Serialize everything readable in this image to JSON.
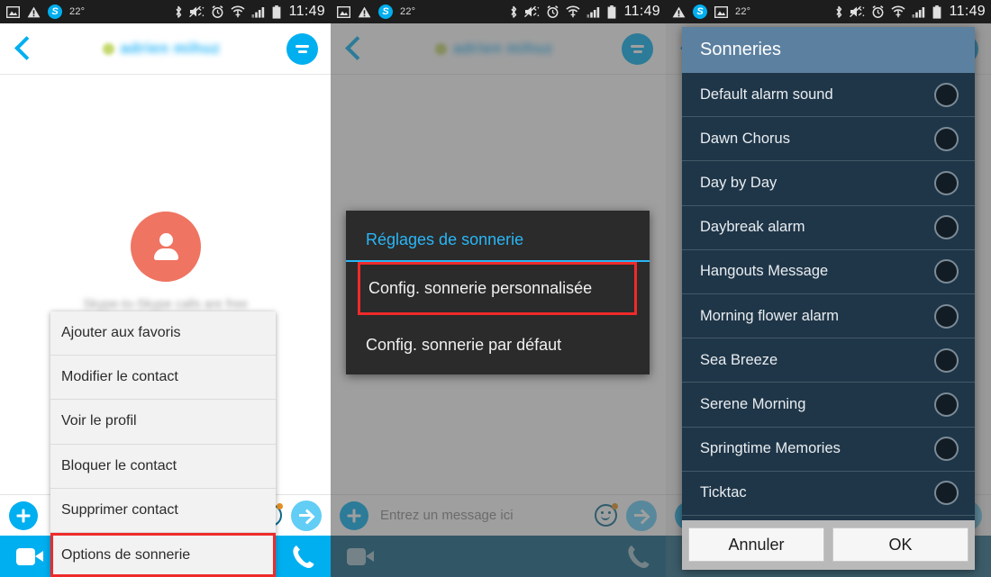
{
  "statusbar": {
    "temperature": "22°",
    "time": "11:49",
    "icons_left": [
      "image-icon",
      "warning-icon",
      "skype-icon"
    ],
    "icons_left_panel3": [
      "warning-icon",
      "skype-icon",
      "image-icon"
    ],
    "icons_right": [
      "bluetooth-icon",
      "vibrate-mute-icon",
      "alarm-icon",
      "wifi-icon",
      "signal-icon",
      "battery-icon"
    ],
    "skype_letter": "S"
  },
  "chat": {
    "contact_name": "adrien mihuz",
    "avatar_subtitle": "Skype-to-Skype calls are free",
    "compose_placeholder": "Entrez un message ici"
  },
  "context_menu": {
    "items": [
      {
        "label": "Ajouter aux favoris",
        "highlighted": false
      },
      {
        "label": "Modifier le contact",
        "highlighted": false
      },
      {
        "label": "Voir le profil",
        "highlighted": false
      },
      {
        "label": "Bloquer le contact",
        "highlighted": false
      },
      {
        "label": "Supprimer contact",
        "highlighted": false
      },
      {
        "label": "Options de sonnerie",
        "highlighted": true
      }
    ]
  },
  "ringtone_settings_dialog": {
    "title": "Réglages de sonnerie",
    "items": [
      {
        "label": "Config. sonnerie personnalisée",
        "highlighted": true
      },
      {
        "label": "Config. sonnerie par défaut",
        "highlighted": false
      }
    ]
  },
  "ringtone_picker": {
    "title": "Sonneries",
    "ringtones": [
      {
        "name": "Default alarm sound",
        "selected": false
      },
      {
        "name": "Dawn Chorus",
        "selected": false
      },
      {
        "name": "Day by Day",
        "selected": false
      },
      {
        "name": "Daybreak alarm",
        "selected": false
      },
      {
        "name": "Hangouts Message",
        "selected": false
      },
      {
        "name": "Morning flower alarm",
        "selected": false
      },
      {
        "name": "Sea Breeze",
        "selected": false
      },
      {
        "name": "Serene Morning",
        "selected": false
      },
      {
        "name": "Springtime Memories",
        "selected": false
      },
      {
        "name": "Ticktac",
        "selected": false
      }
    ],
    "cancel_label": "Annuler",
    "ok_label": "OK"
  },
  "colors": {
    "skype_blue": "#00aff0",
    "status_bar": "#1d1d1d",
    "avatar": "#ef7462",
    "highlight_red": "#ef2a2a",
    "dark_dialog": "#2b2b2b",
    "ring_header": "#5c80a0",
    "ring_list": "#1f3648"
  }
}
